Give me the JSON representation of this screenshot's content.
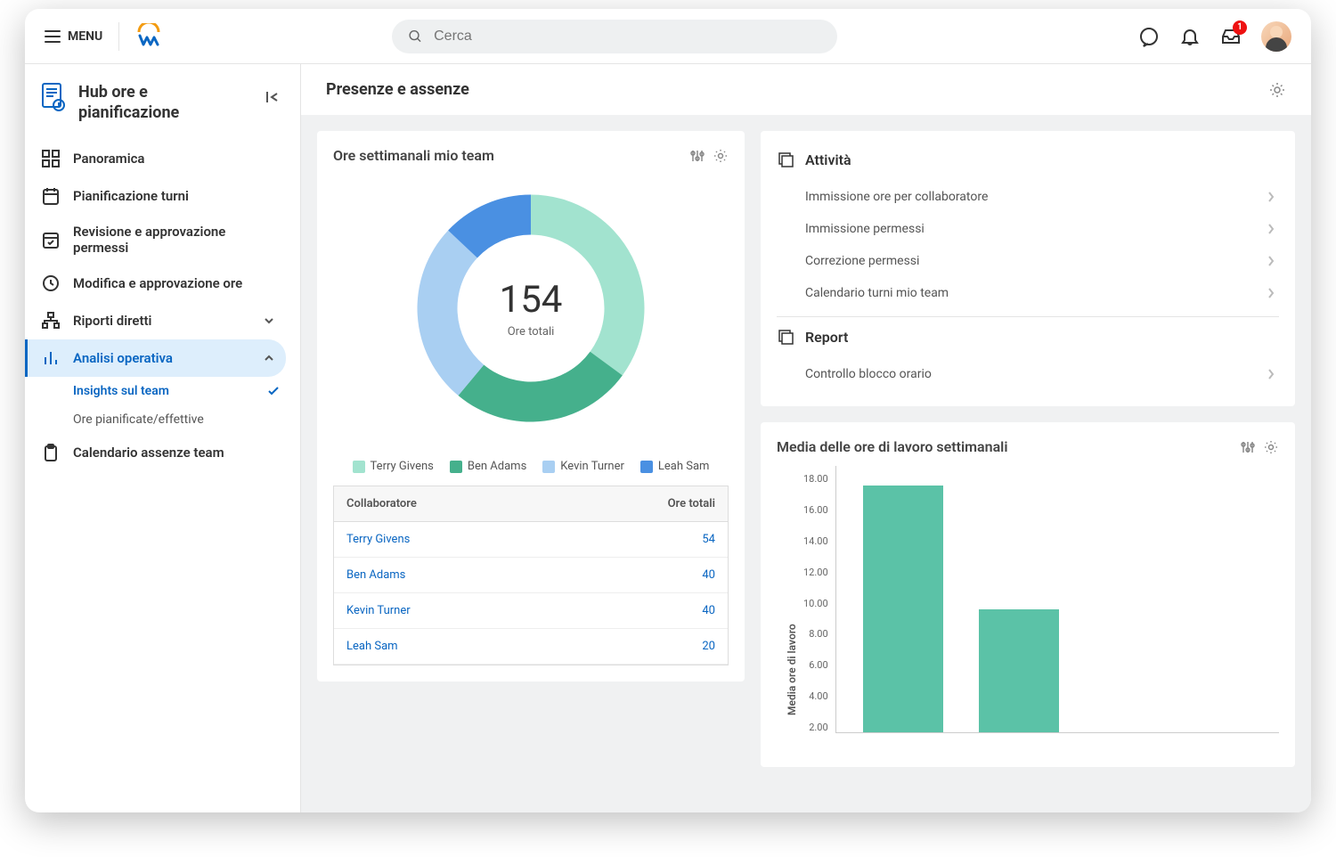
{
  "header": {
    "menu_label": "MENU",
    "search_placeholder": "Cerca",
    "inbox_badge": "1"
  },
  "sidebar": {
    "title": "Hub ore e pianificazione",
    "items": [
      {
        "label": "Panoramica"
      },
      {
        "label": "Pianificazione turni"
      },
      {
        "label": "Revisione e approvazione permessi"
      },
      {
        "label": "Modifica e approvazione ore"
      },
      {
        "label": "Riporti diretti",
        "expandable": true
      },
      {
        "label": "Analisi operativa",
        "expandable": true,
        "active": true
      },
      {
        "label": "Calendario assenze team"
      }
    ],
    "sub_items": [
      {
        "label": "Insights sul team",
        "active": true
      },
      {
        "label": "Ore pianificate/effettive"
      }
    ]
  },
  "main": {
    "title": "Presenze e assenze"
  },
  "donut_card": {
    "title": "Ore settimanali mio team",
    "center_value": "154",
    "center_label": "Ore totali",
    "table_headers": {
      "col1": "Collaboratore",
      "col2": "Ore totali"
    }
  },
  "activity": {
    "title": "Attività",
    "items": [
      {
        "label": "Immissione ore per collaboratore"
      },
      {
        "label": "Immissione permessi"
      },
      {
        "label": "Correzione permessi"
      },
      {
        "label": "Calendario turni mio team"
      }
    ]
  },
  "report": {
    "title": "Report",
    "items": [
      {
        "label": "Controllo blocco orario"
      }
    ]
  },
  "bar_card": {
    "title": "Media delle ore di lavoro settimanali",
    "y_label": "Media ore di lavoro"
  },
  "chart_data": [
    {
      "type": "pie",
      "title": "Ore settimanali mio team",
      "total": 154,
      "total_label": "Ore totali",
      "series": [
        {
          "name": "Terry Givens",
          "value": 54,
          "color": "#a2e3cf"
        },
        {
          "name": "Ben Adams",
          "value": 40,
          "color": "#45b08c"
        },
        {
          "name": "Kevin Turner",
          "value": 40,
          "color": "#a9cff2"
        },
        {
          "name": "Leah Sam",
          "value": 20,
          "color": "#4a90e2"
        }
      ]
    },
    {
      "type": "bar",
      "title": "Media delle ore di lavoro settimanali",
      "ylabel": "Media ore di lavoro",
      "ylim": [
        0,
        18
      ],
      "y_ticks": [
        "18.00",
        "16.00",
        "14.00",
        "12.00",
        "10.00",
        "8.00",
        "6.00",
        "4.00",
        "2.00"
      ],
      "values": [
        16.7,
        8.3
      ],
      "color": "#5bc2a7"
    }
  ]
}
